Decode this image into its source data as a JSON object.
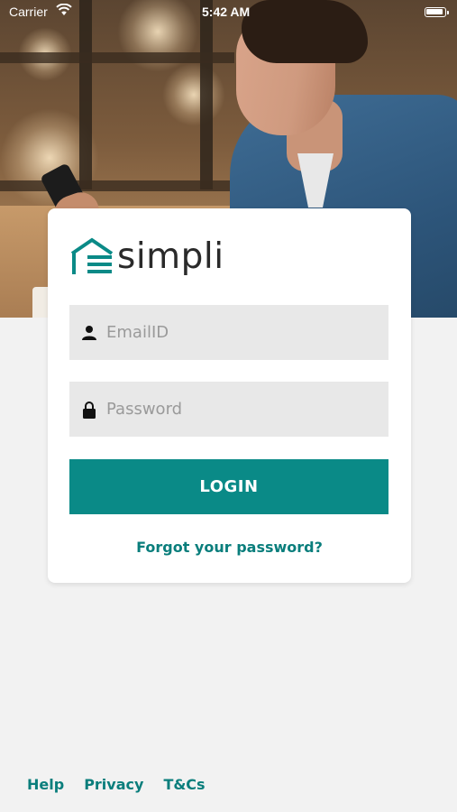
{
  "status_bar": {
    "carrier": "Carrier",
    "time": "5:42 AM"
  },
  "brand": {
    "name": "simpli",
    "accent_color": "#0a8a87",
    "link_color": "#0a7e7c"
  },
  "login_form": {
    "email": {
      "placeholder": "EmailID",
      "value": "",
      "icon": "user-icon"
    },
    "password": {
      "placeholder": "Password",
      "value": "",
      "icon": "lock-icon"
    },
    "login_label": "LOGIN",
    "forgot_label": "Forgot your password?"
  },
  "footer": {
    "links": [
      "Help",
      "Privacy",
      "T&Cs"
    ]
  }
}
